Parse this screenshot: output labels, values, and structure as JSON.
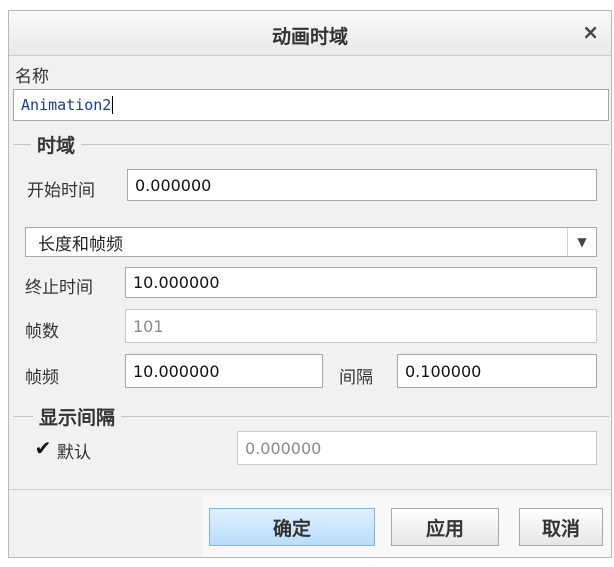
{
  "dialog": {
    "title": "动画时域",
    "close_label": "×"
  },
  "name": {
    "label": "名称",
    "value": "Animation2"
  },
  "time_domain": {
    "group_title": "时域",
    "start_label": "开始时间",
    "start_value": "0.000000",
    "mode_value": "长度和帧频",
    "end_label": "终止时间",
    "end_value": "10.000000",
    "frames_label": "帧数",
    "frames_value": "101",
    "fps_label": "帧频",
    "fps_value": "10.000000",
    "interval_label": "间隔",
    "interval_value": "0.100000"
  },
  "display_interval": {
    "group_title": "显示间隔",
    "default_label": "默认",
    "default_checked": true,
    "check_glyph": "✔",
    "value": "0.000000"
  },
  "buttons": {
    "ok": "确定",
    "apply": "应用",
    "cancel": "取消"
  },
  "icons": {
    "close": "close-icon",
    "dropdown": "chevron-down-icon",
    "check": "checkmark-icon"
  },
  "colors": {
    "ok_button": "#b9ddfb",
    "name_text": "#1b3d8f"
  }
}
